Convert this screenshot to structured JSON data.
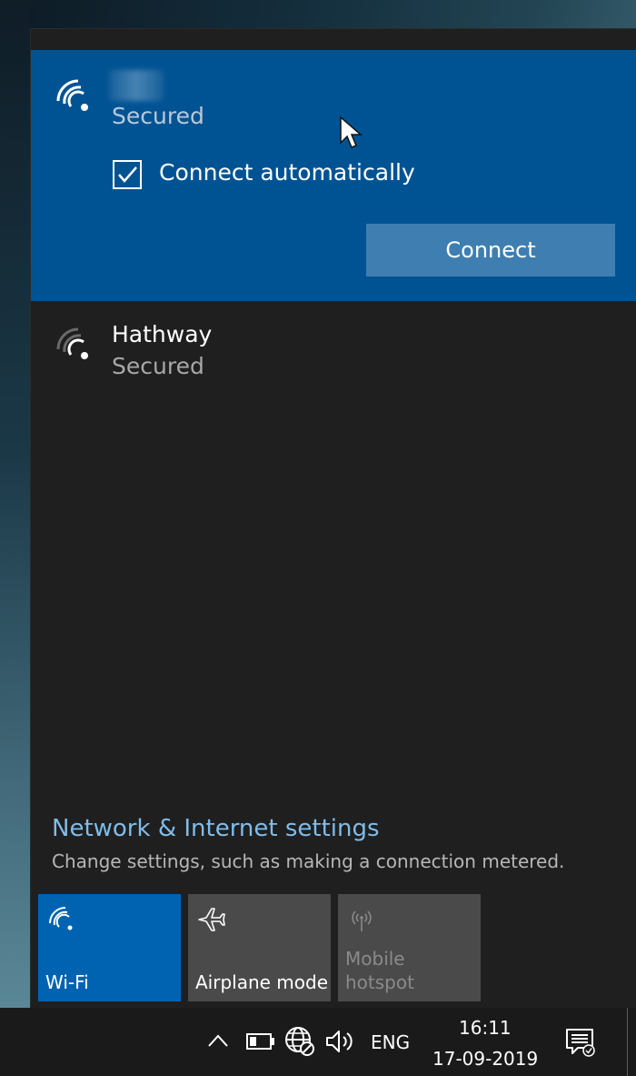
{
  "selected_network": {
    "status": "Secured",
    "connect_automatically_label": "Connect automatically",
    "connect_automatically_checked": true,
    "connect_button_label": "Connect"
  },
  "networks": [
    {
      "name": "Hathway",
      "status": "Secured"
    }
  ],
  "settings": {
    "link_label": "Network & Internet settings",
    "description": "Change settings, such as making a connection metered."
  },
  "quick_actions": [
    {
      "label": "Wi-Fi",
      "state": "on",
      "icon": "wifi-icon"
    },
    {
      "label": "Airplane mode",
      "state": "off",
      "icon": "airplane-icon"
    },
    {
      "label": "Mobile hotspot",
      "state": "disabled",
      "icon": "hotspot-icon"
    }
  ],
  "taskbar": {
    "language": "ENG",
    "time": "16:11",
    "date": "17-09-2019"
  },
  "colors": {
    "accent": "#0063b1",
    "selected_bg": "#005393",
    "link": "#7fbce9",
    "flyout_bg": "#1f1f1f"
  }
}
